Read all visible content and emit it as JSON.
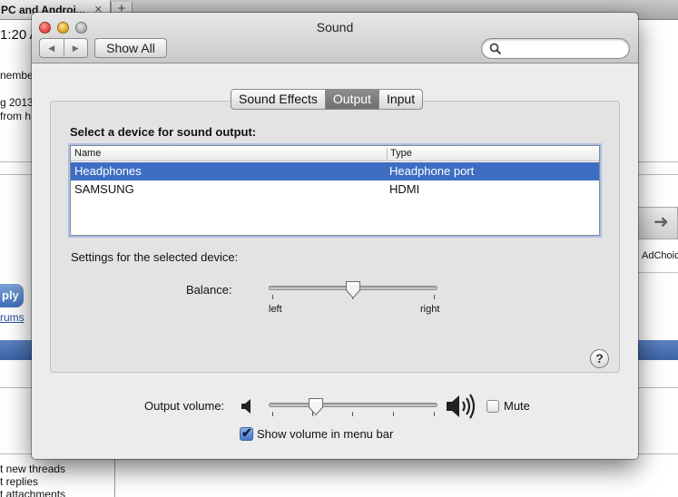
{
  "background": {
    "tab_title": "PC and Androi...",
    "tab_close": "✕",
    "new_tab": "+",
    "time": "1:20 A",
    "lines": [
      "nember",
      "g 2013",
      "from h"
    ],
    "adchoices": "AdChoic",
    "reply_label": "ply",
    "forums_label": "rums",
    "list_items": [
      "t new threads",
      "t replies",
      "t attachments"
    ]
  },
  "window": {
    "title": "Sound",
    "show_all": "Show All",
    "search": {
      "placeholder": "",
      "value": ""
    }
  },
  "tabs": [
    {
      "label": "Sound Effects",
      "active": false
    },
    {
      "label": "Output",
      "active": true
    },
    {
      "label": "Input",
      "active": false
    }
  ],
  "output": {
    "heading": "Select a device for sound output:",
    "columns": [
      "Name",
      "Type"
    ],
    "devices": [
      {
        "name": "Headphones",
        "type": "Headphone port",
        "selected": true
      },
      {
        "name": "SAMSUNG",
        "type": "HDMI",
        "selected": false
      }
    ],
    "settings_label": "Settings for the selected device:",
    "balance": {
      "label": "Balance:",
      "left": "left",
      "right": "right",
      "value": 0.5
    }
  },
  "help": "?",
  "volume": {
    "label": "Output volume:",
    "value": 0.27,
    "mute_label": "Mute",
    "mute_checked": false,
    "show_in_menu_label": "Show volume in menu bar",
    "show_in_menu_checked": true
  },
  "colors": {
    "selection": "#3d6ec3",
    "active_tab": "#7d7d7d",
    "close": "#e0443a",
    "minimize": "#dba11d",
    "zoom": "#a8a8a8"
  }
}
